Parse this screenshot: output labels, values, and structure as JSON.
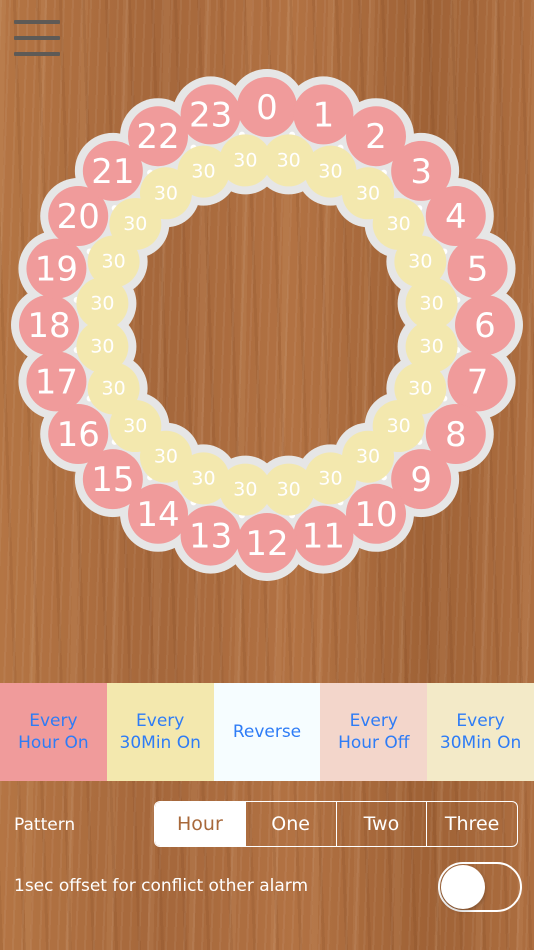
{
  "menu": {
    "icon": "hamburger-menu-icon"
  },
  "dial": {
    "hours": [
      "0",
      "1",
      "2",
      "3",
      "4",
      "5",
      "6",
      "7",
      "8",
      "9",
      "10",
      "11",
      "12",
      "13",
      "14",
      "15",
      "16",
      "17",
      "18",
      "19",
      "20",
      "21",
      "22",
      "23"
    ],
    "half_hour_label": "30",
    "hour_color": "#f09b9b",
    "half_color": "#f3e8ae",
    "rim_color": "#e6e6e6"
  },
  "modes": [
    {
      "label": "Every\nHour On",
      "bg": "#f09b9b"
    },
    {
      "label": "Every\n30Min On",
      "bg": "#f3e8ae"
    },
    {
      "label": "Reverse",
      "bg": "#f6fdff"
    },
    {
      "label": "Every\nHour Off",
      "bg": "#f3d6cb"
    },
    {
      "label": "Every\n30Min On",
      "bg": "#f3eac8"
    }
  ],
  "pattern": {
    "label": "Pattern",
    "options": [
      "Hour",
      "One",
      "Two",
      "Three"
    ],
    "selected": "Hour"
  },
  "offset": {
    "label": "1sec offset for conflict other alarm",
    "enabled": false
  },
  "colors": {
    "accent": "#2e7cf6",
    "wood": "#a8683a"
  }
}
